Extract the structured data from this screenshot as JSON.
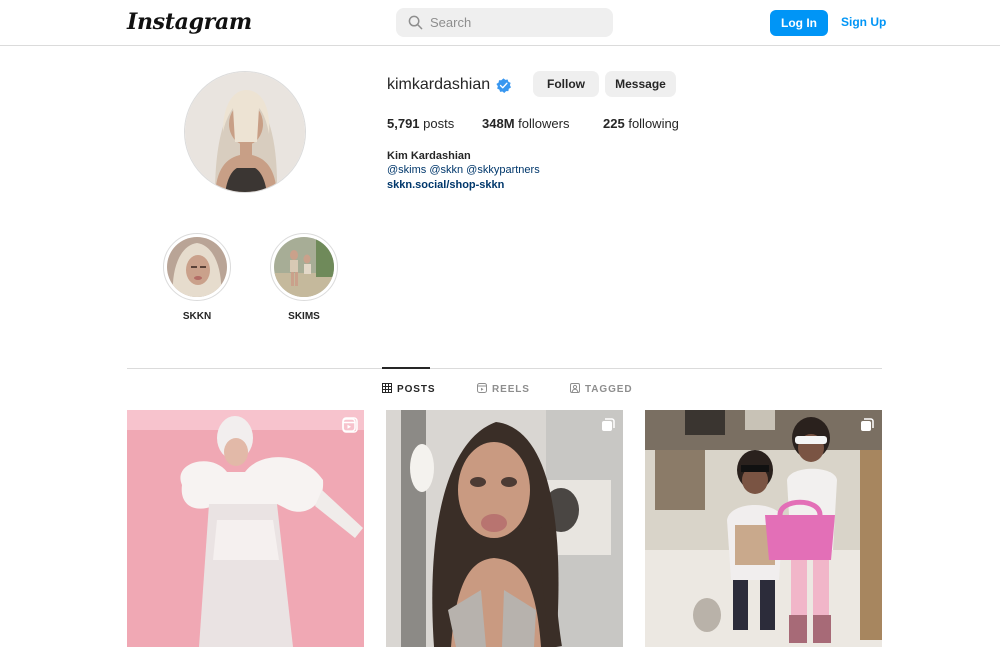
{
  "header": {
    "logo": "Instagram",
    "search_placeholder": "Search",
    "login_label": "Log In",
    "signup_label": "Sign Up",
    "accent_color": "#0095f6"
  },
  "profile": {
    "username": "kimkardashian",
    "verified_icon": "verified-badge-icon",
    "follow_label": "Follow",
    "message_label": "Message",
    "posts_count": "5,791",
    "posts_label": "posts",
    "followers_count": "348M",
    "followers_label": "followers",
    "following_count": "225",
    "following_label": "following",
    "full_name": "Kim Kardashian",
    "mentions": "@skims @skkn @skkypartners",
    "link": "skkn.social/shop-skkn"
  },
  "highlights": [
    {
      "label": "SKKN"
    },
    {
      "label": "SKIMS"
    }
  ],
  "tabs": [
    {
      "label": "POSTS",
      "icon": "grid-icon",
      "active": true
    },
    {
      "label": "REELS",
      "icon": "reels-icon",
      "active": false
    },
    {
      "label": "TAGGED",
      "icon": "tagged-icon",
      "active": false
    }
  ],
  "posts": [
    {
      "type": "reel",
      "badge_icon": "reel-icon"
    },
    {
      "type": "carousel",
      "badge_icon": "carousel-icon"
    },
    {
      "type": "carousel",
      "badge_icon": "carousel-icon"
    }
  ]
}
